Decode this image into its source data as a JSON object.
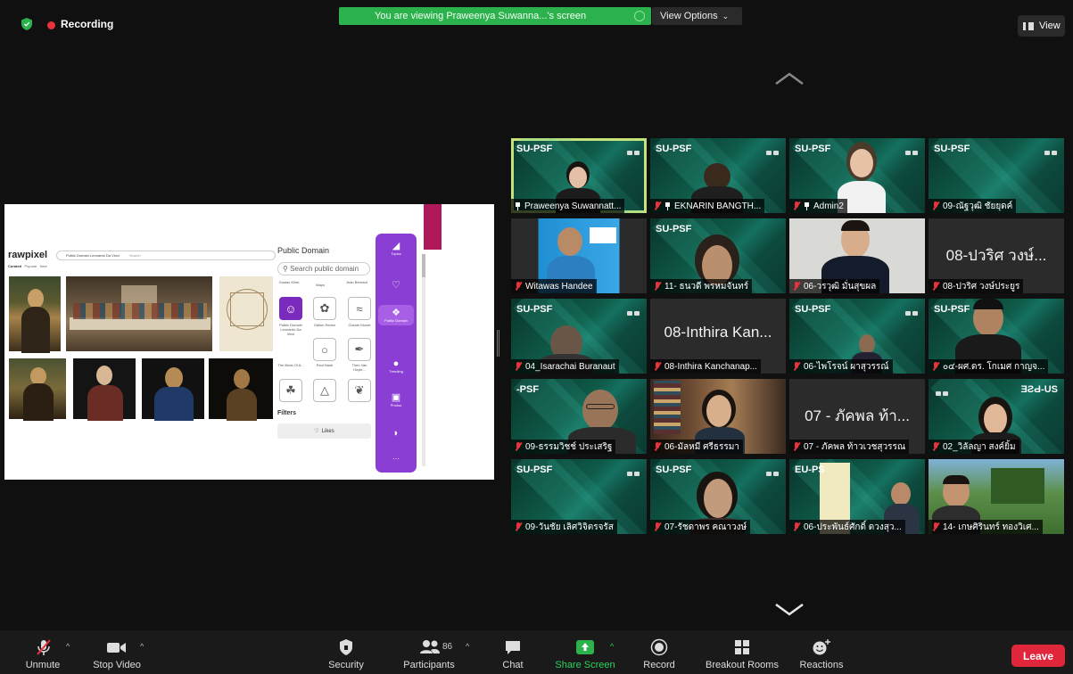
{
  "recording": {
    "label": "Recording"
  },
  "share_banner": {
    "text": "You are viewing Praweenya Suwanna...'s screen"
  },
  "view_options": {
    "label": "View Options"
  },
  "view_button": {
    "label": "View"
  },
  "shared_screen": {
    "logo": "rawpixel",
    "search_value": "Public Domain Leonardo Da Vinci",
    "search_placeholder": "Search",
    "tabs": [
      "Curated",
      "Popular",
      "New"
    ],
    "panel_title": "Public Domain",
    "panel_search_placeholder": "Search public domain",
    "panel_items": [
      "Gustav Klimt",
      "Maps",
      "Jean Bernard",
      "Public Domain Leonardo Da Vinci",
      "Odilon Redon",
      "Claude Monet",
      "The Birds Of A...",
      "Paul Nash",
      "Theo Van Hoyte..."
    ],
    "filters_label": "Filters",
    "likes_label": "Likes",
    "nav": [
      "Topics",
      "Public Domain",
      "Trending",
      "Photos"
    ]
  },
  "gallery": [
    {
      "tag": "SU-PSF",
      "name": "Praweenya Suwannatt...",
      "pinned": true,
      "muted": false
    },
    {
      "tag": "SU-PSF",
      "name": "EKNARIN BANGTH...",
      "pinned": true,
      "muted": true
    },
    {
      "tag": "SU-PSF",
      "name": "Admin2",
      "pinned": true,
      "muted": true
    },
    {
      "tag": "SU-PSF",
      "name": "09-ณัฐวุฒิ ชัยยุดค์",
      "muted": true
    },
    {
      "tag": "",
      "name": "Witawas Handee",
      "muted": true
    },
    {
      "tag": "SU-PSF",
      "name": "11- ธนวดี พรหมจันทร์",
      "muted": true
    },
    {
      "tag": "",
      "name": "06-วรวุฒิ มั่นสุขผล",
      "muted": true
    },
    {
      "tag": "",
      "big": "08-ปวริศ วงษ์...",
      "name": "08-ปวริศ วงษ์ประยูร",
      "muted": true
    },
    {
      "tag": "SU-PSF",
      "name": "04_Isarachai Buranaut",
      "muted": true
    },
    {
      "tag": "",
      "big": "08-Inthira Kan...",
      "name": "08-Inthira Kanchanap...",
      "muted": true
    },
    {
      "tag": "SU-PSF",
      "name": "06-ไพโรจน์ ผาสุวรรณ์",
      "muted": true
    },
    {
      "tag": "SU-PSF",
      "name": "๐๔-ผศ.ดร. โกเมศ กาญจ...",
      "muted": true
    },
    {
      "tag": "-PSF",
      "name": "09-ธรรมวิชช์ ประเสริฐ",
      "muted": true
    },
    {
      "tag": "",
      "name": "06-มัลหมี ศรีธรรมา",
      "muted": true
    },
    {
      "tag": "",
      "big": "07 - ภัคพล ท้า...",
      "name": "07 - ภัคพล ท้าวเวชสุวรรณ",
      "muted": true
    },
    {
      "tag": "ƎƧԀ-US",
      "name": "02_วิลัลญา สงค์ยิ้ม",
      "muted": true
    },
    {
      "tag": "SU-PSF",
      "name": "09-วันชัย เลิศวิจิตรจรัส",
      "muted": true
    },
    {
      "tag": "SU-PSF",
      "name": "07-รัชดาพร คณาวงษ์",
      "muted": true
    },
    {
      "tag": "EU-PS",
      "name": "06-ประพันธ์ศักดิ์ ดวงสุว...",
      "muted": true
    },
    {
      "tag": "",
      "name": "14- เกษศิรินทร์ ทองวิเศ...",
      "muted": true
    }
  ],
  "toolbar": {
    "unmute": "Unmute",
    "stop_video": "Stop Video",
    "security": "Security",
    "participants": "Participants",
    "participants_count": "86",
    "chat": "Chat",
    "share_screen": "Share Screen",
    "record": "Record",
    "breakout_rooms": "Breakout Rooms",
    "reactions": "Reactions",
    "leave": "Leave"
  },
  "colors": {
    "recording": "#e8323c",
    "banner": "#2bb24c",
    "share": "#2bb24c",
    "leave": "#e0263a",
    "active_speaker": "#c5e37a"
  }
}
